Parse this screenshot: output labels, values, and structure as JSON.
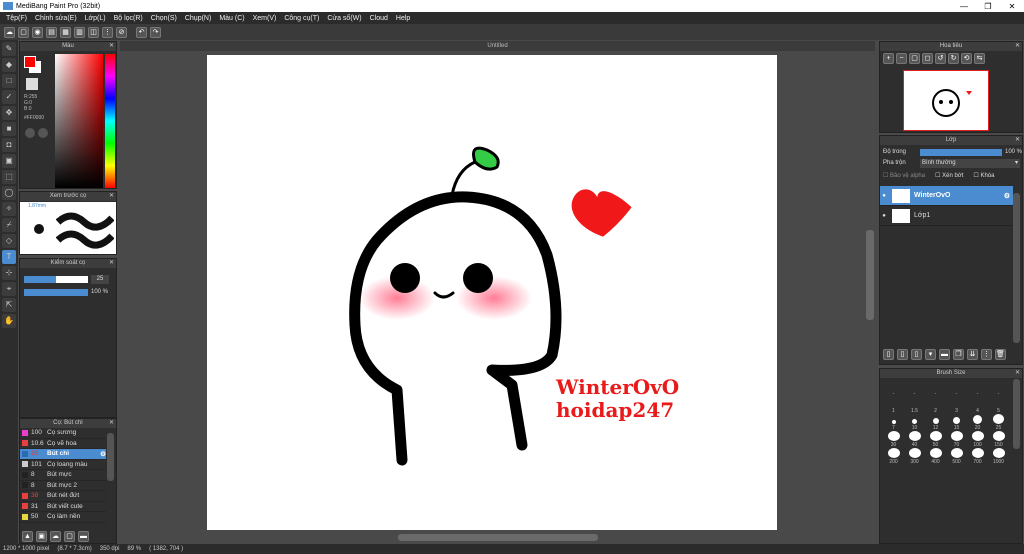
{
  "window": {
    "title": "MediBang Paint Pro (32bit)",
    "minimize": "—",
    "maximize": "❐",
    "close": "✕"
  },
  "menu": [
    "Tệp(F)",
    "Chỉnh sửa(E)",
    "Lớp(L)",
    "Bộ lọc(R)",
    "Chọn(S)",
    "Chụp(N)",
    "Màu (C)",
    "Xem(V)",
    "Công cụ(T)",
    "Cửa sổ(W)",
    "Cloud",
    "Help"
  ],
  "color_panel": {
    "title": "Màu",
    "readout": "R:255\nG:0\nB:0",
    "hex": "#FF0000",
    "primary": "#ff0000",
    "secondary": "#ffffff"
  },
  "preview_panel": {
    "title": "Xem trước cọ",
    "size": "1.87mm"
  },
  "brush_ctrl": {
    "title": "Kiểm soát cọ",
    "size_val": "25",
    "opacity_val": "100 %"
  },
  "brush_list": {
    "title": "Cọ: Bút chì",
    "items": [
      {
        "size": "100",
        "name": "Cọ sương",
        "color": "#e83fd0"
      },
      {
        "size": "10.6",
        "name": "Cọ vẽ hoa",
        "color": "#e83f3f"
      },
      {
        "size": "25",
        "name": "Bút chì",
        "color": "#2a6ab0",
        "selected": true
      },
      {
        "size": "101",
        "name": "Cọ loang màu",
        "color": "#cccccc"
      },
      {
        "size": "8",
        "name": "Bút mực",
        "color": "#222222"
      },
      {
        "size": "8",
        "name": "Bút mực 2",
        "color": "#222222"
      },
      {
        "size": "38",
        "name": "Bút nét đứt",
        "color": "#e83f3f"
      },
      {
        "size": "31",
        "name": "Bút viết cute",
        "color": "#e83f3f"
      },
      {
        "size": "50",
        "name": "Cọ làm nền",
        "color": "#e8d83f"
      }
    ]
  },
  "canvas": {
    "tab": "Untitled",
    "text1": "WinterOvO",
    "text2": "hoidap247"
  },
  "navigator": {
    "title": "Hoa tiêu"
  },
  "layers": {
    "title": "Lớp",
    "opacity_label": "Độ trong",
    "opacity_val": "100 %",
    "blend_label": "Pha trộn",
    "blend_val": "Bình thường",
    "protect_alpha": "Bảo vệ alpha",
    "clipping": "Xén bớt",
    "lock": "Khóa",
    "items": [
      {
        "name": "WinterOvO",
        "selected": true
      },
      {
        "name": "Lớp1",
        "selected": false
      }
    ]
  },
  "brush_size": {
    "title": "Brush Size",
    "sizes": [
      "-",
      "-",
      "-",
      "-",
      "-",
      "-",
      "1",
      "1.5",
      "2",
      "3",
      "4",
      "5",
      "7",
      "10",
      "12",
      "15",
      "20",
      "25",
      "30",
      "40",
      "50",
      "70",
      "100",
      "150",
      "200",
      "300",
      "400",
      "500",
      "700",
      "1000"
    ]
  },
  "status": {
    "dims": "1200 * 1000 pixel",
    "cm": "(8.7 * 7.3cm)",
    "dpi": "350 dpi",
    "zoom": "89 %",
    "coords": "( 1382, 704 )"
  }
}
